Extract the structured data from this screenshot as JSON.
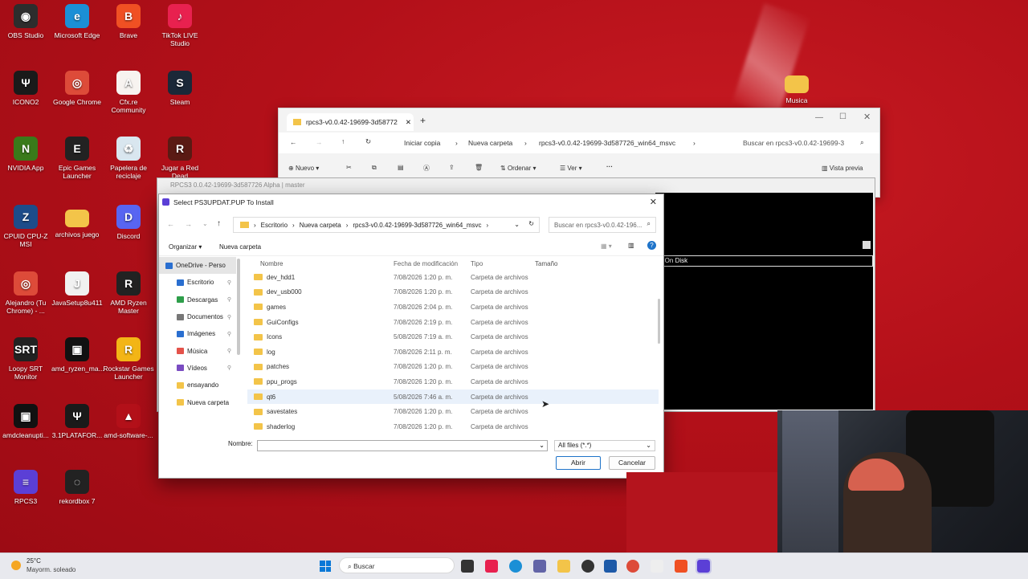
{
  "desktop_icons": [
    {
      "label": "OBS Studio",
      "glyph": "◉",
      "color": "#2d2d2d"
    },
    {
      "label": "Microsoft Edge",
      "glyph": "e",
      "color": "#1b8fd6"
    },
    {
      "label": "Brave",
      "glyph": "B",
      "color": "#f05023"
    },
    {
      "label": "TikTok LIVE Studio",
      "glyph": "♪",
      "color": "#e8214f"
    },
    {
      "label": "ICONO2",
      "glyph": "Ψ",
      "color": "#1a1a1a"
    },
    {
      "label": "Google Chrome",
      "glyph": "◎",
      "color": "#dd4b39"
    },
    {
      "label": "Cfx.re Community",
      "glyph": "A",
      "color": "#f7f3f0"
    },
    {
      "label": "Steam",
      "glyph": "S",
      "color": "#1b2838"
    },
    {
      "label": "NVIDIA App",
      "glyph": "N",
      "color": "#3a7a1a"
    },
    {
      "label": "Epic Games Launcher",
      "glyph": "E",
      "color": "#222"
    },
    {
      "label": "Papelera de reciclaje",
      "glyph": "♻",
      "color": "#d9e6ef"
    },
    {
      "label": "Jugar a Red Dead Redemption 2",
      "glyph": "R",
      "color": "#5a1a14"
    },
    {
      "label": "CPUID CPU-Z MSI",
      "glyph": "Z",
      "color": "#1d4c8a"
    },
    {
      "label": "archivos juego",
      "glyph": "",
      "color": "#f3c449"
    },
    {
      "label": "Discord",
      "glyph": "D",
      "color": "#5865f2"
    },
    {
      "label": "Alejandro (Tu Chrome) - ...",
      "glyph": "◎",
      "color": "#dd4b39"
    },
    {
      "label": "JavaSetup8u411",
      "glyph": "J",
      "color": "#f1f1f1"
    },
    {
      "label": "AMD Ryzen Master",
      "glyph": "R",
      "color": "#222"
    },
    {
      "label": "Loopy SRT Monitor",
      "glyph": "SRT",
      "color": "#222"
    },
    {
      "label": "amd_ryzen_ma...",
      "glyph": "▣",
      "color": "#111"
    },
    {
      "label": "Rockstar Games Launcher",
      "glyph": "R",
      "color": "#f3b516"
    },
    {
      "label": "amdcleanupti...",
      "glyph": "▣",
      "color": "#111"
    },
    {
      "label": "3.1PLATAFOR...",
      "glyph": "Ψ",
      "color": "#1a1a1a"
    },
    {
      "label": "amd-software-...",
      "glyph": "▲",
      "color": "#b31019"
    },
    {
      "label": "RPCS3",
      "glyph": "≡",
      "color": "#5b3fd6"
    },
    {
      "label": "rekordbox 7",
      "glyph": "◌",
      "color": "#222"
    },
    {
      "label": "Musica",
      "glyph": "",
      "color": "#f3c449"
    }
  ],
  "explorer": {
    "tab_title": "rpcs3-v0.0.42-19699-3d58772",
    "breadcrumb": [
      "Iniciar copia",
      "Nueva carpeta",
      "rpcs3-v0.0.42-19699-3d587726_win64_msvc"
    ],
    "search_placeholder": "Buscar en rpcs3-v0.0.42-19699-3",
    "new_label": "Nuevo",
    "sort_label": "Ordenar",
    "view_label": "Ver",
    "preview_label": "Vista previa"
  },
  "rpcs3": {
    "title": "RPCS3 0.0.42-19699-3d587726 Alpha | master",
    "console_text": "e On Disk"
  },
  "dialog": {
    "title": "Select PS3UPDAT.PUP To Install",
    "path": [
      "Escritorio",
      "Nueva carpeta",
      "rpcs3-v0.0.42-19699-3d587726_win64_msvc"
    ],
    "search_placeholder": "Buscar en rpcs3-v0.0.42-196...",
    "organize_label": "Organizar",
    "new_folder_label": "Nueva carpeta",
    "nav_items": [
      "OneDrive - Perso",
      "Escritorio",
      "Descargas",
      "Documentos",
      "Imágenes",
      "Música",
      "Vídeos",
      "ensayando",
      "Nueva carpeta"
    ],
    "columns": [
      "Nombre",
      "Fecha de modificación",
      "Tipo",
      "Tamaño"
    ],
    "files": [
      {
        "name": "dev_hdd1",
        "date": "7/08/2026 1:20 p. m.",
        "type": "Carpeta de archivos"
      },
      {
        "name": "dev_usb000",
        "date": "7/08/2026 1:20 p. m.",
        "type": "Carpeta de archivos"
      },
      {
        "name": "games",
        "date": "7/08/2026 2:04 p. m.",
        "type": "Carpeta de archivos"
      },
      {
        "name": "GuiConfigs",
        "date": "7/08/2026 2:19 p. m.",
        "type": "Carpeta de archivos"
      },
      {
        "name": "Icons",
        "date": "5/08/2026 7:19 a. m.",
        "type": "Carpeta de archivos"
      },
      {
        "name": "log",
        "date": "7/08/2026 2:11 p. m.",
        "type": "Carpeta de archivos"
      },
      {
        "name": "patches",
        "date": "7/08/2026 1:20 p. m.",
        "type": "Carpeta de archivos"
      },
      {
        "name": "ppu_progs",
        "date": "7/08/2026 1:20 p. m.",
        "type": "Carpeta de archivos"
      },
      {
        "name": "qt6",
        "date": "5/08/2026 7:46 a. m.",
        "type": "Carpeta de archivos"
      },
      {
        "name": "savestates",
        "date": "7/08/2026 1:20 p. m.",
        "type": "Carpeta de archivos"
      },
      {
        "name": "shaderlog",
        "date": "7/08/2026 1:20 p. m.",
        "type": "Carpeta de archivos"
      }
    ],
    "name_label": "Nombre:",
    "name_value": "",
    "filter_value": "All files (*.*)",
    "open_label": "Abrir",
    "cancel_label": "Cancelar"
  },
  "taskbar": {
    "weather_temp": "25°C",
    "weather_desc": "Mayorm. soleado",
    "search_placeholder": "Buscar"
  }
}
